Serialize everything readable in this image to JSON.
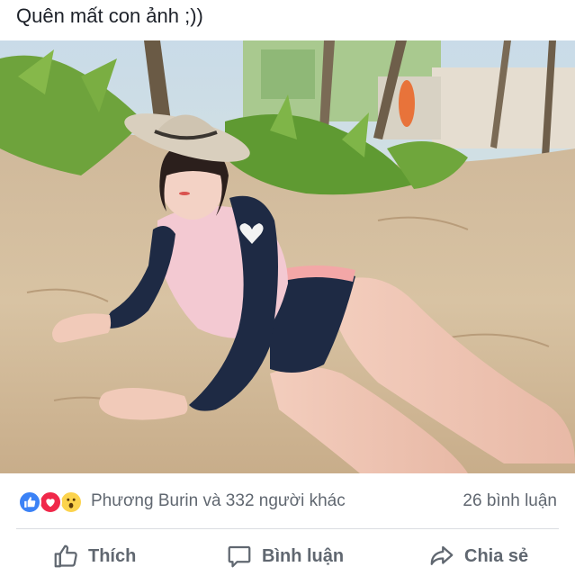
{
  "post": {
    "caption": "Quên mất con ảnh ;))"
  },
  "reactions": {
    "icons": [
      "like-icon",
      "love-icon",
      "wow-icon"
    ],
    "colors": {
      "like": "#3b82f6",
      "love": "#f0284a",
      "wow": "#fcd34d"
    },
    "summary": "Phương Burin và 332 người khác",
    "comments": "26 bình luận"
  },
  "actions": {
    "like": "Thích",
    "comment": "Bình luận",
    "share": "Chia sẻ",
    "icons": [
      "thumbs-up-icon",
      "speech-bubble-icon",
      "share-arrow-icon"
    ],
    "color": "#606770"
  }
}
